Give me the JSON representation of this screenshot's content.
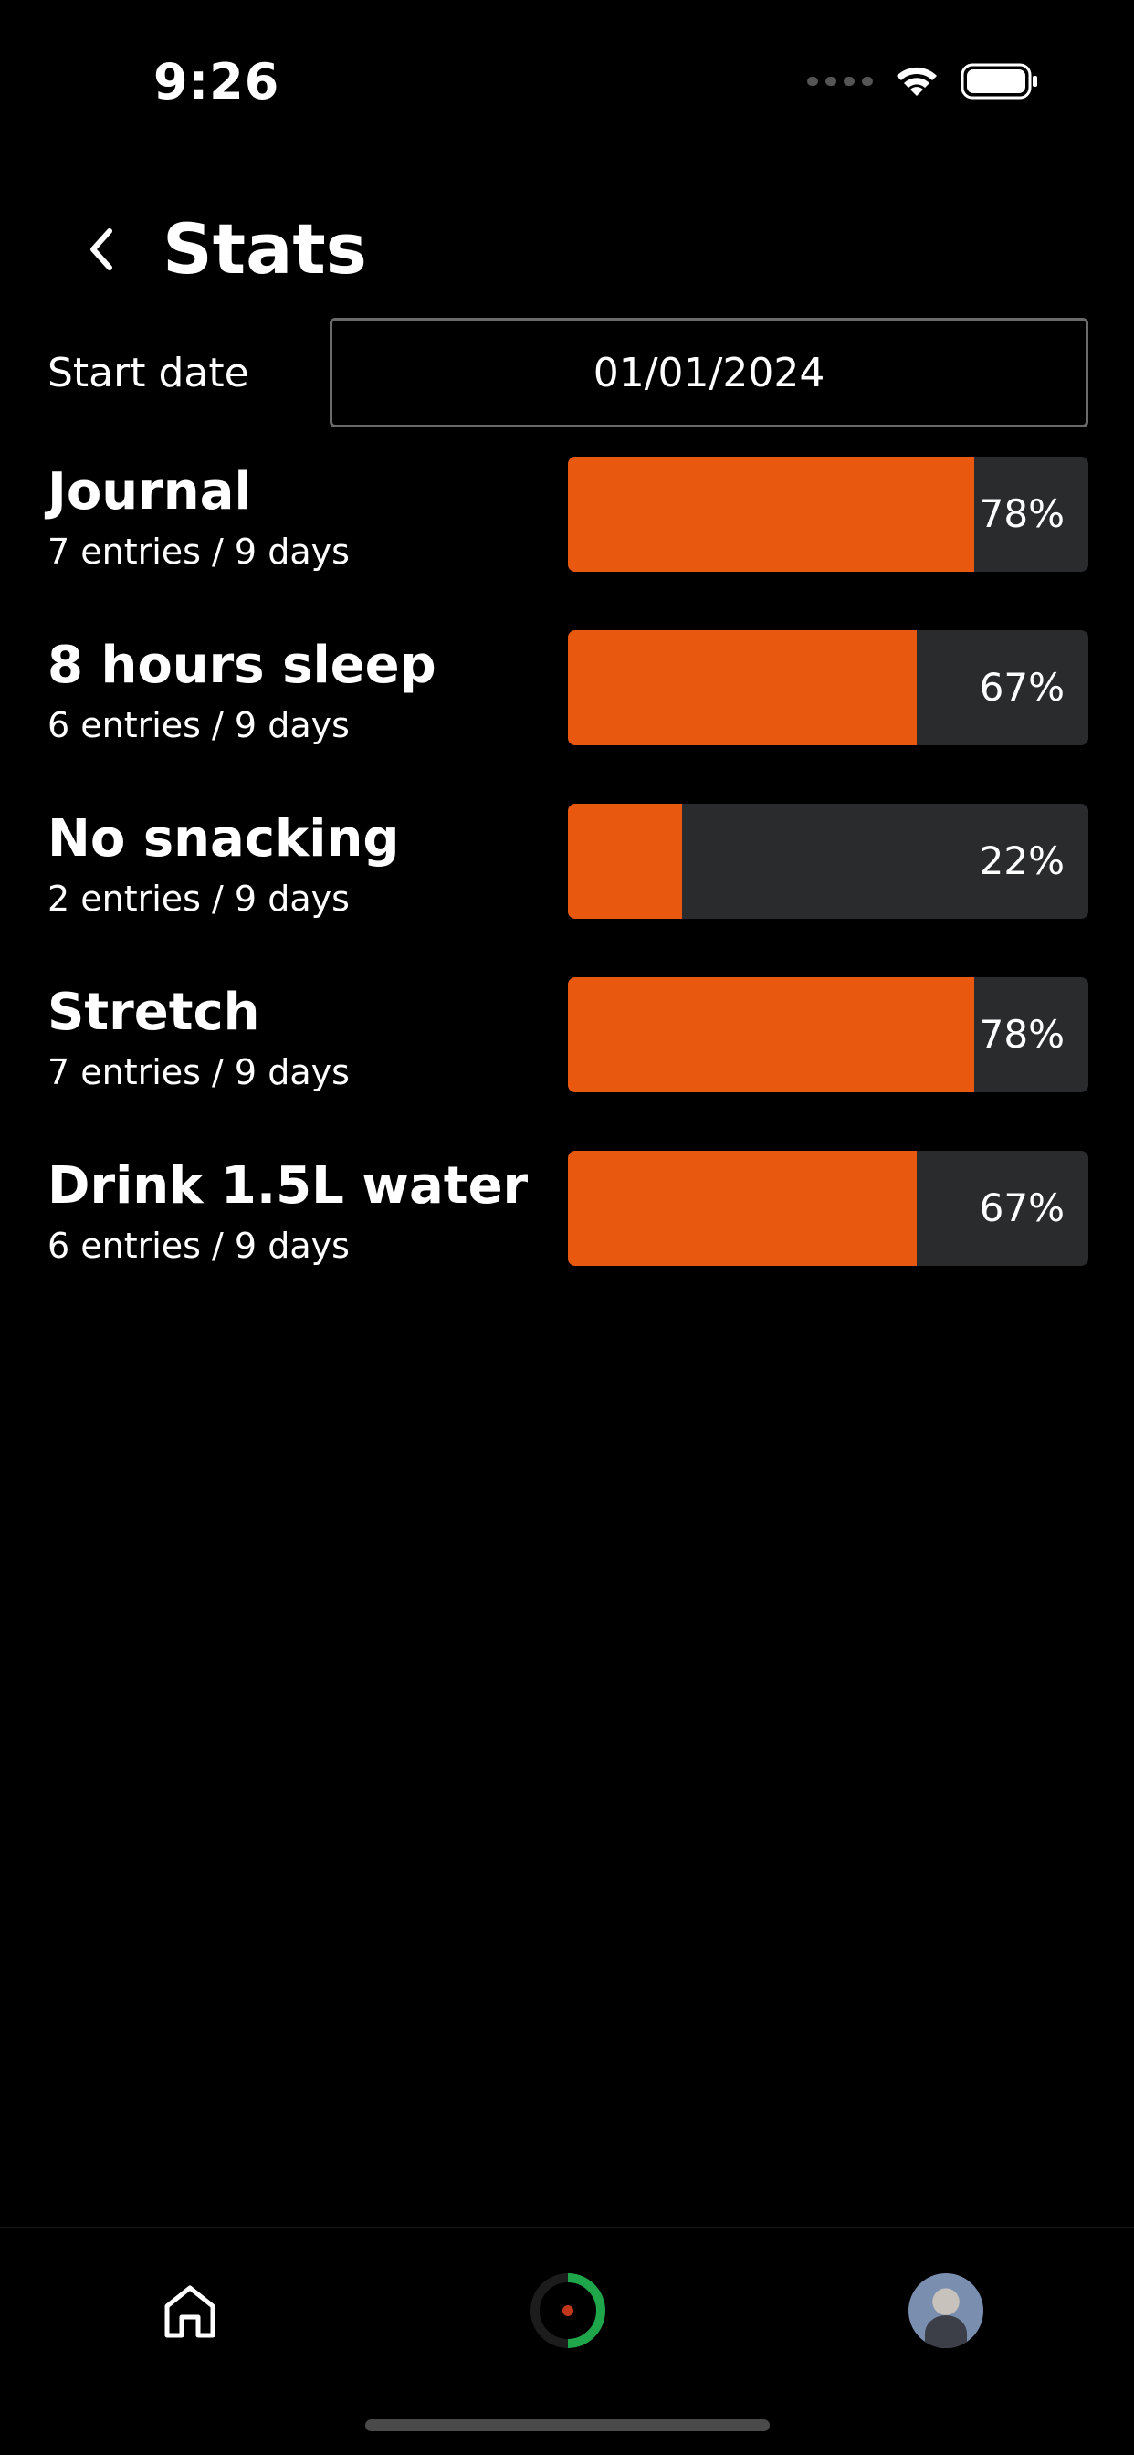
{
  "status_bar": {
    "time": "9:26"
  },
  "header": {
    "title": "Stats"
  },
  "start_date": {
    "label": "Start date",
    "value": "01/01/2024"
  },
  "habits": [
    {
      "name": "Journal",
      "detail": "7 entries / 9 days",
      "percent_label": "78%",
      "fraction": 0.78
    },
    {
      "name": "8 hours sleep",
      "detail": "6 entries / 9 days",
      "percent_label": "67%",
      "fraction": 0.67
    },
    {
      "name": "No snacking",
      "detail": "2 entries / 9 days",
      "percent_label": "22%",
      "fraction": 0.22
    },
    {
      "name": "Stretch",
      "detail": "7 entries / 9 days",
      "percent_label": "78%",
      "fraction": 0.78
    },
    {
      "name": "Drink 1.5L water",
      "detail": "6 entries / 9 days",
      "percent_label": "67%",
      "fraction": 0.67
    }
  ],
  "colors": {
    "background": "#000000",
    "accent": "#e8580e",
    "bar_track": "#2a2b2d",
    "ring_progress": "#1fa54a"
  },
  "nav": {
    "items": [
      {
        "icon": "home-icon"
      },
      {
        "icon": "progress-ring-icon"
      },
      {
        "icon": "avatar"
      }
    ]
  }
}
